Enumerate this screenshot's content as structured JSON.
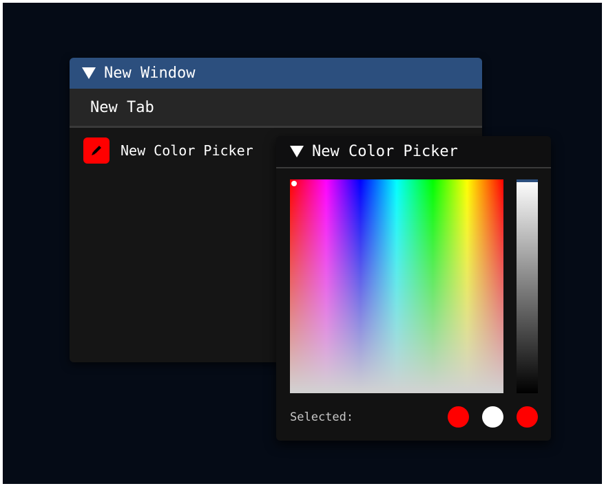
{
  "main_window": {
    "title": "New Window",
    "tab": "New Tab",
    "items": [
      {
        "label": "New Color Picker",
        "swatch_color": "#ff0000",
        "icon": "pencil-icon"
      }
    ]
  },
  "color_picker": {
    "title": "New Color Picker",
    "selected_label": "Selected:",
    "swatches": [
      "#ff0000",
      "#ffffff",
      "#ff0000"
    ]
  },
  "colors": {
    "accent": "#2c4f7e",
    "background": "#050b16"
  }
}
